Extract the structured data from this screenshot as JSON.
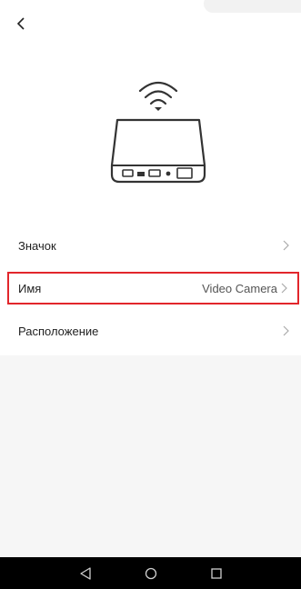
{
  "header": {
    "back_icon": "chevron-left-icon"
  },
  "illustration": {
    "icon": "wifi-device-icon"
  },
  "settings": [
    {
      "label": "Значок",
      "value": "",
      "icon": "chevron-right-icon"
    },
    {
      "label": "Имя",
      "value": "Video Camera",
      "icon": "chevron-right-icon",
      "highlighted": true
    },
    {
      "label": "Расположение",
      "value": "",
      "icon": "chevron-right-icon"
    }
  ],
  "nav_bar": {
    "back_icon": "triangle-back-icon",
    "home_icon": "circle-home-icon",
    "recents_icon": "square-recents-icon"
  },
  "colors": {
    "highlight": "#e2262b",
    "nav_bar": "#000000",
    "gray_area": "#f6f6f6"
  }
}
